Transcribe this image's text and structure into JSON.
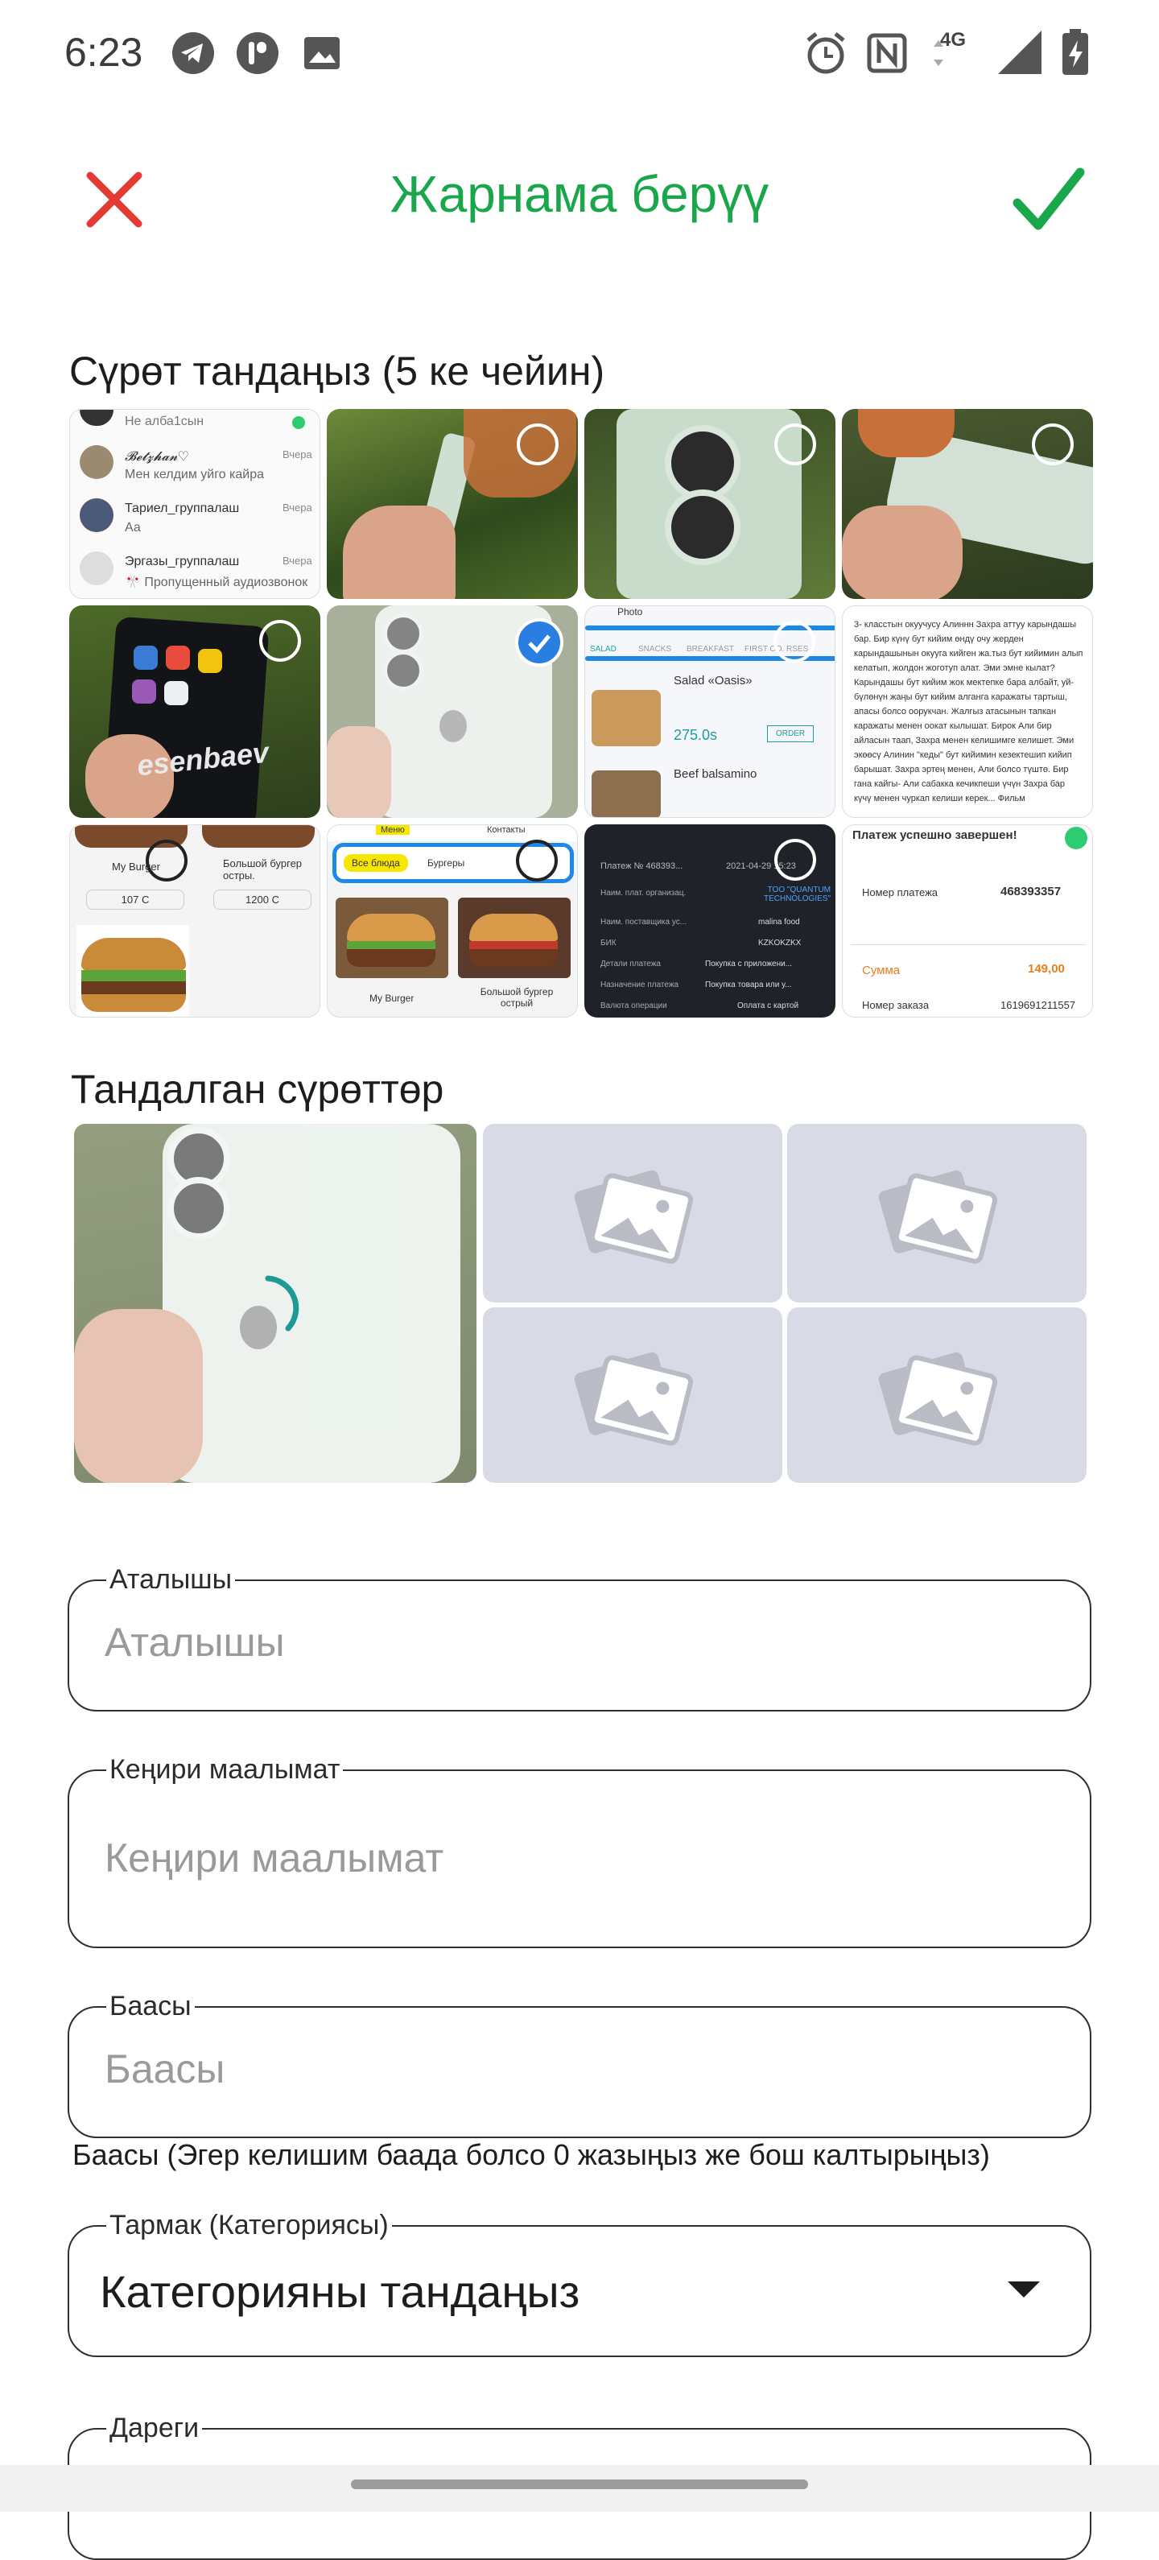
{
  "status_bar": {
    "time": "6:23",
    "network": "4G",
    "icons": [
      "telegram-icon",
      "app-icon",
      "image-icon",
      "alarm-icon",
      "nfc-icon",
      "signal-icon",
      "battery-icon"
    ]
  },
  "app_bar": {
    "title": "Жарнама берүү",
    "close_icon": "close-icon",
    "confirm_icon": "check-icon",
    "accent_color": "#1aa64b",
    "close_color": "#e53935"
  },
  "gallery": {
    "heading": "Сүрөт тандаңыз (5 ке чейин)",
    "tiles": [
      {
        "kind": "screenshot-chats",
        "lines": [
          "Не алба1сын",
          "𝓑𝓮𝓽𝔃𝓱𝓪𝓷♡",
          "Мен келдим уйго кайра",
          "Тариел_группалаш",
          "Аа",
          "Эргазы_группалаш",
          "🎌 Пропущенный аудиозвонок"
        ],
        "times": [
          "Вчера",
          "Вчера",
          "Вчера"
        ],
        "selected": false
      },
      {
        "kind": "photo-phone-side",
        "selected": false
      },
      {
        "kind": "photo-phone-camera",
        "selected": false
      },
      {
        "kind": "photo-phone-bottom",
        "selected": false
      },
      {
        "kind": "photo-phone-screen",
        "text": "esenbaev",
        "selected": false
      },
      {
        "kind": "photo-phone-back",
        "selected": true
      },
      {
        "kind": "screenshot-menu",
        "title": "Photo",
        "tabs": [
          "SALAD",
          "SNACKS",
          "BREAKFAST",
          "FIRST CO. RSES"
        ],
        "items": [
          "Salad «Oasis»",
          "Beef balsamino"
        ],
        "price": "275.0s",
        "order": "ORDER",
        "selected": false
      },
      {
        "kind": "screenshot-text",
        "text": "3- класстын окуучусу Алиннн Захра аттуу карындашы бар. Бир күнү бут кийим өндү очу жерден карындашынын окууга кийген жа.тыз бут кийимин алып келатып, жолдон жоготуп алат. Эми эмне кылат? Карындашы бут кийим жок мектепке бара албайт, уй-бүлөнүн жаңы бут кийим алганга каражаты тартыш, апасы болсо оорукчан. Жалгыз атасынын тапкан каражаты менен оокат кылышат. Бирок Али бир айласын таап, Захра менен келишимге келишет. Эми экөөсү Алинин \"кеды\" бут кийимин кезектешип кийип барышат. Захра эртең менен, Али болсо түштө. Бир гана кайгы- Али сабакка кечикпеши үчүн Захра бар күчү менен чуркап келиши керек... Фильм",
        "selected": false
      },
      {
        "kind": "screenshot-burgers",
        "items": [
          "My Burger",
          "107 С",
          "Большой бургер остры.",
          "1200 С"
        ],
        "selected": false
      },
      {
        "kind": "screenshot-burgers-menu",
        "tabs": [
          "Меню",
          "Контакты"
        ],
        "chips": [
          "Все блюда",
          "Бургеры"
        ],
        "items": [
          "My Burger",
          "Большой бургер острый"
        ],
        "selected": false
      },
      {
        "kind": "screenshot-payment-dark",
        "rows": [
          [
            "Платеж № 468393...",
            "2021-04-29 15:23"
          ],
          [
            "Наим. плат. организац.",
            "TOO \"QUANTUM TECHNOLOGIES\""
          ],
          [
            "Наим. поставщика ус...",
            "malina food"
          ],
          [
            "БИК",
            "KZKOKZKX"
          ],
          [
            "Детали платежа",
            "Покупка с приложени..."
          ],
          [
            "Назначение платежа",
            "Покупка товара или у..."
          ],
          [
            "Валюта операции",
            "Оплата с картой"
          ]
        ],
        "selected": false
      },
      {
        "kind": "screenshot-payment-light",
        "title": "Платеж успешно завершен!",
        "rows": [
          [
            "Номер платежа",
            "468393357"
          ],
          [
            "Сумма",
            "149,00"
          ],
          [
            "Номер заказа",
            "1619691211557"
          ]
        ],
        "selected": false
      }
    ]
  },
  "selected_section": {
    "heading": "Тандалган сүрөттөр",
    "slots": [
      {
        "kind": "photo",
        "loading": true
      },
      {
        "kind": "placeholder",
        "icon": "image-placeholder-icon"
      },
      {
        "kind": "placeholder",
        "icon": "image-placeholder-icon"
      },
      {
        "kind": "placeholder",
        "icon": "image-placeholder-icon"
      },
      {
        "kind": "placeholder",
        "icon": "image-placeholder-icon"
      }
    ]
  },
  "form": {
    "title_field": {
      "label": "Аталышы",
      "placeholder": "Аталышы",
      "value": ""
    },
    "description_field": {
      "label": "Кеңири маалымат",
      "placeholder": "Кеңири маалымат",
      "value": ""
    },
    "price_field": {
      "label": "Баасы",
      "placeholder": "Баасы",
      "value": "",
      "helper": "Баасы (Эгер келишим баада болсо 0 жазыңыз же бош калтырыңыз)"
    },
    "category_field": {
      "label": "Тармак (Категориясы)",
      "value": "Категорияны тандаңыз"
    },
    "address_field": {
      "label": "Дареги"
    }
  }
}
